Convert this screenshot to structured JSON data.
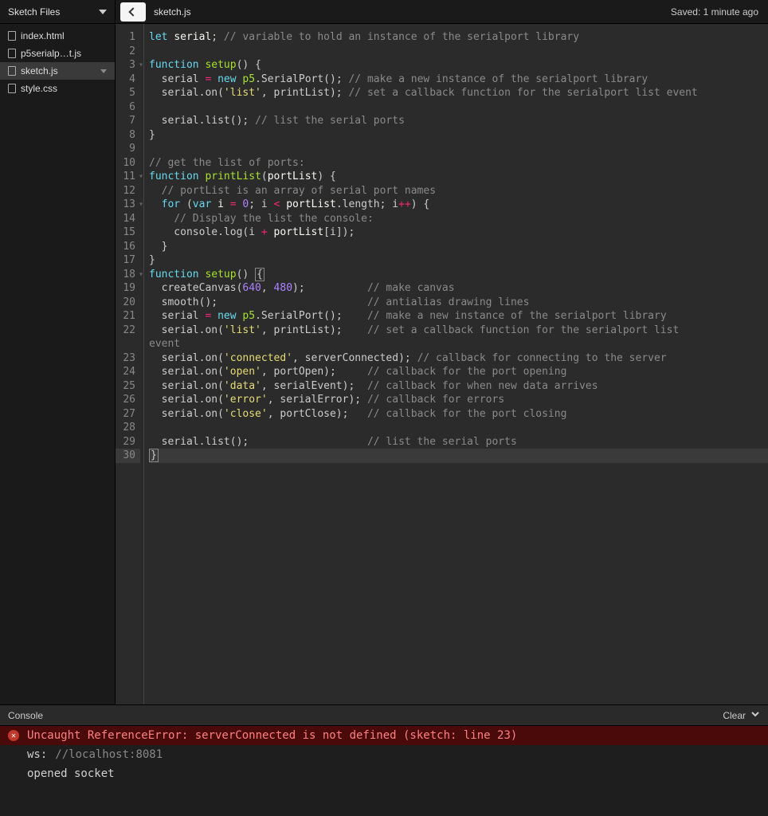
{
  "header": {
    "sketch_files_label": "Sketch Files",
    "filename": "sketch.js",
    "saved_status": "Saved: 1 minute ago"
  },
  "sidebar": {
    "files": [
      {
        "label": "index.html",
        "active": false
      },
      {
        "label": "p5serialp…t.js",
        "active": false
      },
      {
        "label": "sketch.js",
        "active": true
      },
      {
        "label": "style.css",
        "active": false
      }
    ]
  },
  "editor": {
    "lines": [
      {
        "n": 1,
        "fold": false,
        "hl": false,
        "tokens": [
          [
            "kw",
            "let"
          ],
          [
            "",
            " "
          ],
          [
            "var",
            "serial"
          ],
          [
            "",
            ";"
          ],
          [
            "",
            ""
          ],
          [
            "com",
            " // variable to hold an instance of the serialport library"
          ]
        ]
      },
      {
        "n": 2,
        "fold": false,
        "hl": false,
        "tokens": [
          [
            "",
            ""
          ]
        ]
      },
      {
        "n": 3,
        "fold": true,
        "hl": false,
        "tokens": [
          [
            "kw",
            "function"
          ],
          [
            "",
            ""
          ],
          [
            "def",
            " setup"
          ],
          [
            "",
            "() {"
          ]
        ]
      },
      {
        "n": 4,
        "fold": false,
        "hl": false,
        "tokens": [
          [
            "",
            "  serial "
          ],
          [
            "op",
            "="
          ],
          [
            "",
            ""
          ],
          [
            "kw",
            " new"
          ],
          [
            "",
            ""
          ],
          [
            "def",
            " p5"
          ],
          [
            "",
            ".SerialPort(); "
          ],
          [
            "com",
            "// make a new instance of the serialport library"
          ]
        ]
      },
      {
        "n": 5,
        "fold": false,
        "hl": false,
        "tokens": [
          [
            "",
            "  serial.on("
          ],
          [
            "str",
            "'list'"
          ],
          [
            "",
            ", printList); "
          ],
          [
            "com",
            "// set a callback function for the serialport list event"
          ]
        ]
      },
      {
        "n": 6,
        "fold": false,
        "hl": false,
        "tokens": [
          [
            "",
            ""
          ]
        ]
      },
      {
        "n": 7,
        "fold": false,
        "hl": false,
        "tokens": [
          [
            "",
            "  serial.list(); "
          ],
          [
            "com",
            "// list the serial ports"
          ]
        ]
      },
      {
        "n": 8,
        "fold": false,
        "hl": false,
        "tokens": [
          [
            "",
            "}"
          ]
        ]
      },
      {
        "n": 9,
        "fold": false,
        "hl": false,
        "tokens": [
          [
            "",
            ""
          ]
        ]
      },
      {
        "n": 10,
        "fold": false,
        "hl": false,
        "tokens": [
          [
            "com",
            "// get the list of ports:"
          ]
        ]
      },
      {
        "n": 11,
        "fold": true,
        "hl": false,
        "tokens": [
          [
            "kw",
            "function"
          ],
          [
            "",
            ""
          ],
          [
            "def",
            " printList"
          ],
          [
            "",
            "("
          ],
          [
            "var",
            "portList"
          ],
          [
            "",
            ") {"
          ]
        ]
      },
      {
        "n": 12,
        "fold": false,
        "hl": false,
        "tokens": [
          [
            "",
            "  "
          ],
          [
            "com",
            "// portList is an array of serial port names"
          ]
        ]
      },
      {
        "n": 13,
        "fold": true,
        "hl": false,
        "tokens": [
          [
            "",
            "  "
          ],
          [
            "kw",
            "for"
          ],
          [
            "",
            ""
          ],
          [
            "",
            ""
          ],
          [
            "",
            ""
          ],
          [
            "",
            ""
          ],
          [
            "",
            ""
          ],
          [
            "",
            ""
          ],
          [
            "",
            " ("
          ],
          [
            "kw",
            "var"
          ],
          [
            "",
            ""
          ],
          [
            "var",
            " i"
          ],
          [
            "",
            ""
          ],
          [
            "op",
            " ="
          ],
          [
            "",
            ""
          ],
          [
            "num",
            " 0"
          ],
          [
            "",
            "; i "
          ],
          [
            "op",
            "<"
          ],
          [
            "",
            ""
          ],
          [
            "var",
            " portList"
          ],
          [
            "",
            ".length; i"
          ],
          [
            "op",
            "++"
          ],
          [
            "",
            ") {"
          ]
        ]
      },
      {
        "n": 14,
        "fold": false,
        "hl": false,
        "tokens": [
          [
            "",
            "    "
          ],
          [
            "com",
            "// Display the list the console:"
          ]
        ]
      },
      {
        "n": 15,
        "fold": false,
        "hl": false,
        "tokens": [
          [
            "",
            "    console.log(i "
          ],
          [
            "op",
            "+"
          ],
          [
            "",
            ""
          ],
          [
            "var",
            " portList"
          ],
          [
            "",
            "[i]);"
          ]
        ]
      },
      {
        "n": 16,
        "fold": false,
        "hl": false,
        "tokens": [
          [
            "",
            "  }"
          ]
        ]
      },
      {
        "n": 17,
        "fold": false,
        "hl": false,
        "tokens": [
          [
            "",
            "}"
          ]
        ]
      },
      {
        "n": 18,
        "fold": true,
        "hl": false,
        "tokens": [
          [
            "kw",
            "function"
          ],
          [
            "",
            ""
          ],
          [
            "def",
            " setup"
          ],
          [
            "",
            "() "
          ],
          [
            "brace-match",
            "{"
          ]
        ]
      },
      {
        "n": 19,
        "fold": false,
        "hl": false,
        "tokens": [
          [
            "",
            "  createCanvas("
          ],
          [
            "num",
            "640"
          ],
          [
            "",
            ", "
          ],
          [
            "num",
            "480"
          ],
          [
            "",
            ");          "
          ],
          [
            "com",
            "// make canvas"
          ]
        ]
      },
      {
        "n": 20,
        "fold": false,
        "hl": false,
        "tokens": [
          [
            "",
            "  smooth();                        "
          ],
          [
            "com",
            "// antialias drawing lines"
          ]
        ]
      },
      {
        "n": 21,
        "fold": false,
        "hl": false,
        "tokens": [
          [
            "",
            "  serial "
          ],
          [
            "op",
            "="
          ],
          [
            "",
            ""
          ],
          [
            "kw",
            " new"
          ],
          [
            "",
            ""
          ],
          [
            "def",
            " p5"
          ],
          [
            "",
            ".SerialPort();    "
          ],
          [
            "com",
            "// make a new instance of the serialport library"
          ]
        ]
      },
      {
        "n": 22,
        "fold": false,
        "hl": false,
        "tokens": [
          [
            "",
            "  serial.on("
          ],
          [
            "str",
            "'list'"
          ],
          [
            "",
            ", printList);    "
          ],
          [
            "com",
            "// set a callback function for the serialport list "
          ]
        ]
      },
      {
        "n": "",
        "fold": false,
        "hl": false,
        "tokens": [
          [
            "com",
            "event"
          ]
        ]
      },
      {
        "n": 23,
        "fold": false,
        "hl": false,
        "tokens": [
          [
            "",
            "  serial.on("
          ],
          [
            "str",
            "'connected'"
          ],
          [
            "",
            ", serverConnected); "
          ],
          [
            "com",
            "// callback for connecting to the server"
          ]
        ]
      },
      {
        "n": 24,
        "fold": false,
        "hl": false,
        "tokens": [
          [
            "",
            "  serial.on("
          ],
          [
            "str",
            "'open'"
          ],
          [
            "",
            ", portOpen);     "
          ],
          [
            "com",
            "// callback for the port opening"
          ]
        ]
      },
      {
        "n": 25,
        "fold": false,
        "hl": false,
        "tokens": [
          [
            "",
            "  serial.on("
          ],
          [
            "str",
            "'data'"
          ],
          [
            "",
            ", serialEvent);  "
          ],
          [
            "com",
            "// callback for when new data arrives"
          ]
        ]
      },
      {
        "n": 26,
        "fold": false,
        "hl": false,
        "tokens": [
          [
            "",
            "  serial.on("
          ],
          [
            "str",
            "'error'"
          ],
          [
            "",
            ", serialError); "
          ],
          [
            "com",
            "// callback for errors"
          ]
        ]
      },
      {
        "n": 27,
        "fold": false,
        "hl": false,
        "tokens": [
          [
            "",
            "  serial.on("
          ],
          [
            "str",
            "'close'"
          ],
          [
            "",
            ", portClose);   "
          ],
          [
            "com",
            "// callback for the port closing"
          ]
        ]
      },
      {
        "n": 28,
        "fold": false,
        "hl": false,
        "tokens": [
          [
            "",
            ""
          ]
        ]
      },
      {
        "n": 29,
        "fold": false,
        "hl": false,
        "tokens": [
          [
            "",
            "  serial.list();                   "
          ],
          [
            "com",
            "// list the serial ports"
          ]
        ]
      },
      {
        "n": 30,
        "fold": false,
        "hl": true,
        "tokens": [
          [
            "brace-match",
            "}"
          ]
        ]
      }
    ]
  },
  "console": {
    "title": "Console",
    "clear_label": "Clear",
    "entries": [
      {
        "type": "error",
        "text": "Uncaught ReferenceError: serverConnected is not defined (sketch: line 23)"
      },
      {
        "type": "plain",
        "prefix": "ws:",
        "text": "//localhost:8081"
      },
      {
        "type": "plain",
        "prefix": "",
        "text": "opened socket"
      }
    ]
  }
}
